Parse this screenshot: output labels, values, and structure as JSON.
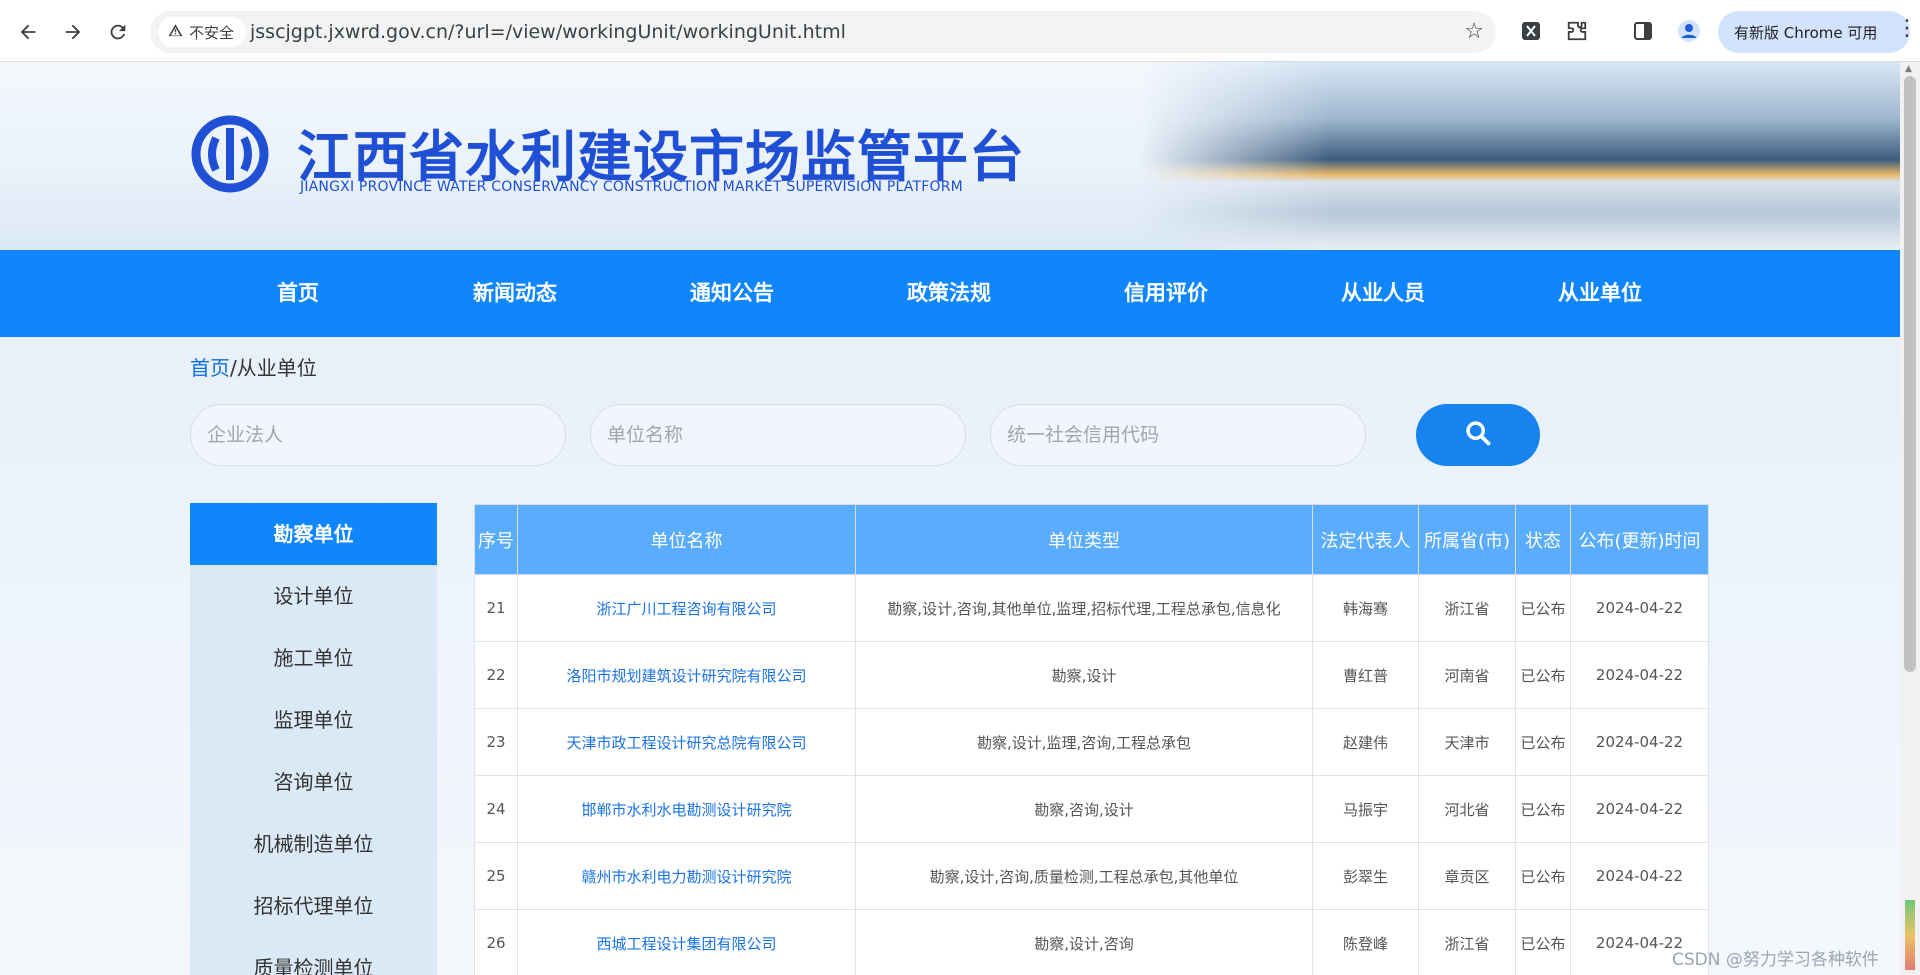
{
  "browser": {
    "security_label": "不安全",
    "url": "jsscjgpt.jxwrd.gov.cn/?url=/view/workingUnit/workingUnit.html",
    "update_label": "有新版 Chrome 可用"
  },
  "site": {
    "title": "江西省水利建设市场监管平台",
    "subtitle": "JIANGXI PROVINCE WATER CONSERVANCY CONSTRUCTION MARKET SUPERVISION PLATFORM",
    "brand_color": "#1f4fd4",
    "nav_color": "#0f86fe"
  },
  "nav": [
    {
      "label": "首页"
    },
    {
      "label": "新闻动态"
    },
    {
      "label": "通知公告"
    },
    {
      "label": "政策法规"
    },
    {
      "label": "信用评价"
    },
    {
      "label": "从业人员"
    },
    {
      "label": "从业单位"
    }
  ],
  "breadcrumb": {
    "home": "首页",
    "current": "/从业单位"
  },
  "search": {
    "legal_placeholder": "企业法人",
    "name_placeholder": "单位名称",
    "credit_placeholder": "统一社会信用代码"
  },
  "side_menu": [
    {
      "label": "勘察单位",
      "active": true
    },
    {
      "label": "设计单位"
    },
    {
      "label": "施工单位"
    },
    {
      "label": "监理单位"
    },
    {
      "label": "咨询单位"
    },
    {
      "label": "机械制造单位"
    },
    {
      "label": "招标代理单位"
    },
    {
      "label": "质量检测单位"
    }
  ],
  "table": {
    "headers": {
      "no": "序号",
      "name": "单位名称",
      "type": "单位类型",
      "rep": "法定代表人",
      "prov": "所属省(市)",
      "status": "状态",
      "date": "公布(更新)时间"
    },
    "rows": [
      {
        "no": "21",
        "name": "浙江广川工程咨询有限公司",
        "type": "勘察,设计,咨询,其他单位,监理,招标代理,工程总承包,信息化",
        "rep": "韩海骞",
        "prov": "浙江省",
        "status": "已公布",
        "date": "2024-04-22"
      },
      {
        "no": "22",
        "name": "洛阳市规划建筑设计研究院有限公司",
        "type": "勘察,设计",
        "rep": "曹红普",
        "prov": "河南省",
        "status": "已公布",
        "date": "2024-04-22"
      },
      {
        "no": "23",
        "name": "天津市政工程设计研究总院有限公司",
        "type": "勘察,设计,监理,咨询,工程总承包",
        "rep": "赵建伟",
        "prov": "天津市",
        "status": "已公布",
        "date": "2024-04-22"
      },
      {
        "no": "24",
        "name": "邯郸市水利水电勘测设计研究院",
        "type": "勘察,咨询,设计",
        "rep": "马振宇",
        "prov": "河北省",
        "status": "已公布",
        "date": "2024-04-22"
      },
      {
        "no": "25",
        "name": "赣州市水利电力勘测设计研究院",
        "type": "勘察,设计,咨询,质量检测,工程总承包,其他单位",
        "rep": "彭翠生",
        "prov": "章贡区",
        "status": "已公布",
        "date": "2024-04-22"
      },
      {
        "no": "26",
        "name": "西城工程设计集团有限公司",
        "type": "勘察,设计,咨询",
        "rep": "陈登峰",
        "prov": "浙江省",
        "status": "已公布",
        "date": "2024-04-22"
      }
    ]
  },
  "watermark": "CSDN @努力学习各种软件"
}
